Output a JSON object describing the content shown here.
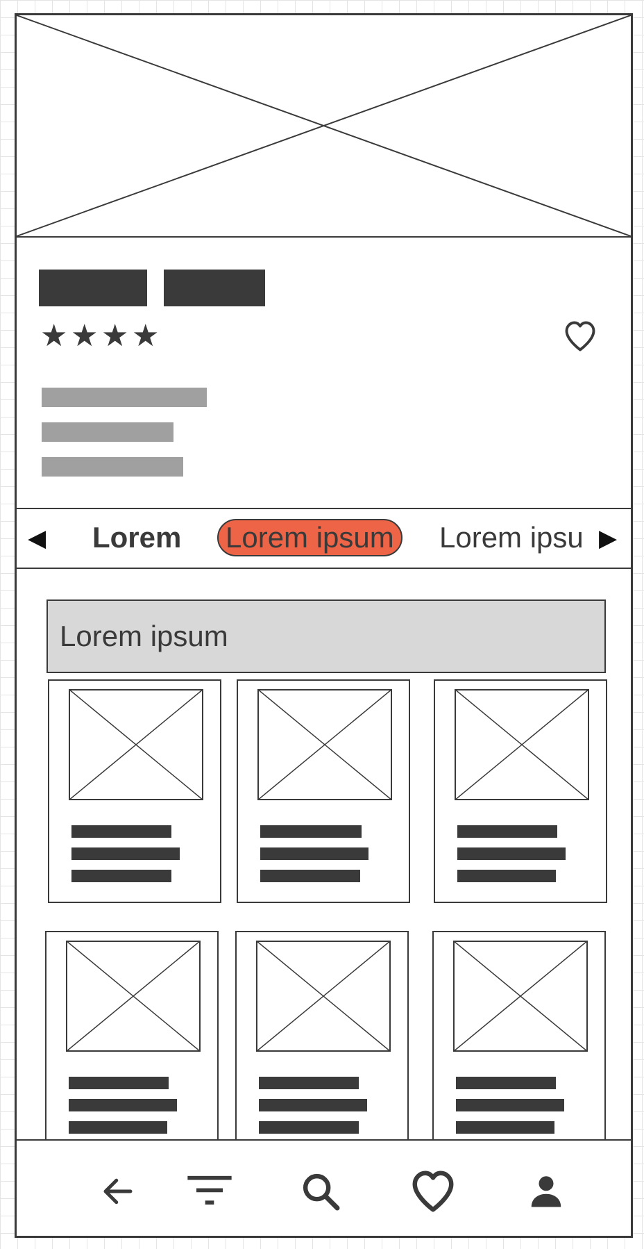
{
  "filters": {
    "items": [
      {
        "label": "Lorem"
      },
      {
        "label": "Lorem ipsum",
        "selected": true
      },
      {
        "label": "Lorem ipsu"
      }
    ],
    "selected_color": "#ee6446"
  },
  "section": {
    "title": "Lorem ipsum"
  },
  "product": {
    "rating": 4,
    "rating_max": 4
  },
  "icons": {
    "prev": "caret-left-icon",
    "next": "caret-right-icon",
    "favorite": "heart-outline-icon",
    "nav": [
      "arrow-left-icon",
      "filter-icon",
      "search-icon",
      "heart-icon",
      "user-icon"
    ]
  },
  "colors": {
    "ink": "#3a3a3a",
    "accent": "#ee6446",
    "placeholder_text": "#a0a0a0",
    "section_bg": "#d8d8d8"
  }
}
